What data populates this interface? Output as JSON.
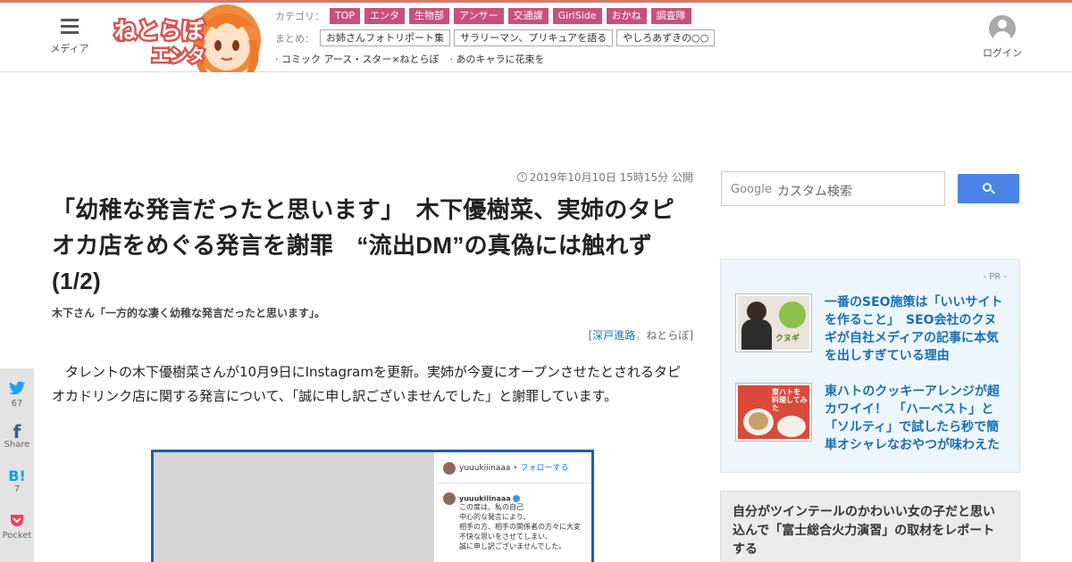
{
  "header": {
    "menu_label": "メディア",
    "logo_text_main": "ねとらぼ",
    "logo_text_sub": "エンタ",
    "category_label": "カテゴリ：",
    "categories": [
      "TOP",
      "エンタ",
      "生物部",
      "アンサー",
      "交通課",
      "GirlSide",
      "おかね",
      "調査隊"
    ],
    "summary_label": "まとめ：",
    "summaries": [
      "お姉さんフォトリポート集",
      "サラリーマン、プリキュアを語る",
      "やしろあずきの○○"
    ],
    "features": [
      "· コミック アース・スター×ねとらぼ",
      "· あのキャラに花束を"
    ],
    "login_label": "ログイン"
  },
  "share": {
    "twitter_icon": "twitter-icon",
    "twitter_count": "67",
    "facebook_label": "Share",
    "hatena_icon_text": "B!",
    "hatena_count": "7",
    "pocket_label": "Pocket"
  },
  "article": {
    "pubdate": "2019年10月10日 15時15分 公開",
    "headline": "「幼稚な発言だったと思います」　木下優樹菜、実姉のタピオカ店をめぐる発言を謝罪　“流出DM”の真偽には触れず (1/2)",
    "subhead": "木下さん「一方的な凄く幼稚な発言だったと思います」。",
    "byline_open": "[",
    "author": "深戸進路",
    "byline_sep": "，",
    "publisher": "ねとらぼ",
    "byline_close": "]",
    "body": "　タレントの木下優樹菜さんが10月9日にInstagramを更新。実姉が今夏にオープンさせたとされるタピオカドリンク店に関する発言について、「誠に申し訳ございませんでした」と謝罪しています。"
  },
  "figure": {
    "ig_user": "yuuukiiinaaa",
    "ig_follow": "• フォローする",
    "ig_post": "この度は、私の自己\n中心的な発言により、\n相手の方、相手の関係者の方々に大変\n不快な思いをさせてしまい、\n誠に申し訳ございませんでした。\n\n私の発言は\nいくら大切な家族のための事とは言え"
  },
  "sidebar": {
    "search_logo": "Google",
    "search_placeholder": "カスタム検索",
    "pr_label": "- PR -",
    "pr_items": [
      {
        "title": "一番のSEO施策は「いいサイトを作ること」　SEO会社のクヌギが自社メディアの記事に本気を出しすぎている理由",
        "thumb_text": "クヌギ"
      },
      {
        "title": "東ハトのクッキーアレンジが超カワイイ！　「ハーベスト」と「ソルティ」で試したら秒で簡単オシャレなおやつが味わえた",
        "thumb_text": "東ハトを料理してみた"
      }
    ],
    "rank_text": "自分がツインテールのかわいい女の子だと思い込んで「富士総合火力演習」の取材をレポートする"
  },
  "colors": {
    "accent_bar": "#d9776e",
    "category_tag": "#c8507e",
    "link_blue": "#1a6fb5",
    "search_button": "#4a84e6",
    "figure_border": "#1c5fa8"
  }
}
